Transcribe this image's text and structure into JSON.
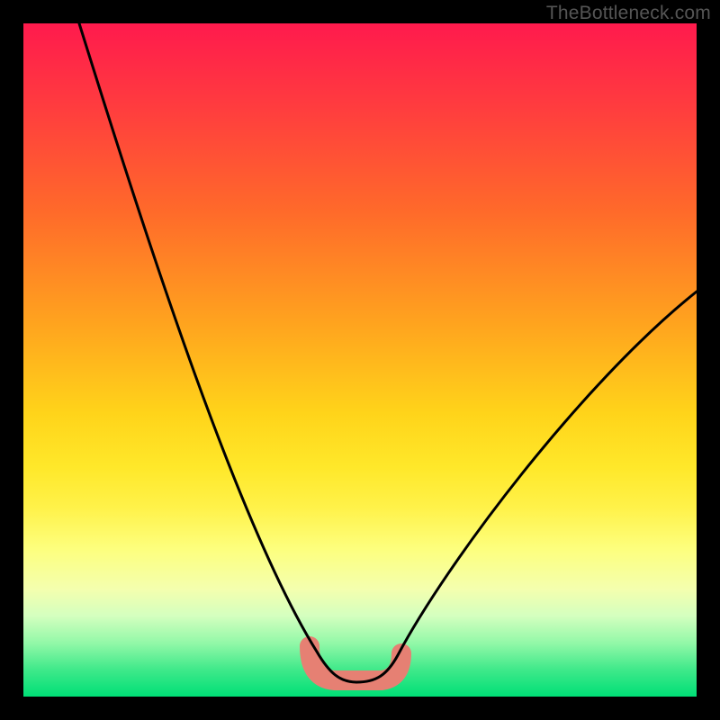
{
  "watermark": "TheBottleneck.com",
  "chart_data": {
    "type": "line",
    "title": "",
    "xlabel": "",
    "ylabel": "",
    "xlim": [
      0,
      100
    ],
    "ylim": [
      0,
      100
    ],
    "grid": false,
    "series": [
      {
        "name": "bottleneck-curve",
        "x": [
          8,
          12,
          16,
          20,
          24,
          28,
          32,
          36,
          40,
          42,
          44,
          46,
          48,
          50,
          52,
          56,
          60,
          66,
          72,
          78,
          84,
          90,
          96,
          100
        ],
        "values": [
          100,
          90,
          80,
          70,
          60,
          50,
          40,
          30,
          20,
          14,
          8,
          4,
          1,
          0,
          1,
          4,
          10,
          18,
          26,
          34,
          41,
          48,
          55,
          60
        ]
      }
    ],
    "annotations": [
      {
        "name": "flat-bottom-marker",
        "x_start": 42,
        "x_end": 55,
        "y": 3
      }
    ],
    "colors": {
      "curve": "#000000",
      "marker": "#e68073",
      "gradient_top": "#ff1a4d",
      "gradient_bottom": "#00df76"
    }
  }
}
